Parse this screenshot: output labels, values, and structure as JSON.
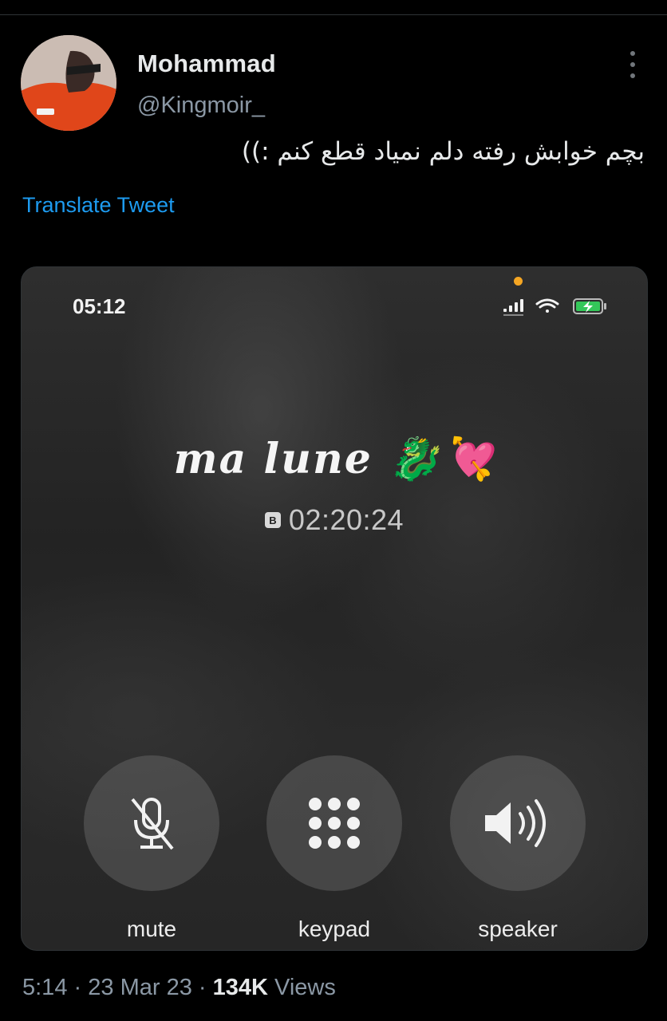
{
  "tweet": {
    "display_name": "Mohammad",
    "handle": "@Kingmoir_",
    "text": "بچم خوابش رفته دلم نمیاد قطع کنم :))",
    "translate_label": "Translate Tweet",
    "time": "5:14",
    "separator": "·",
    "date": "23 Mar 23",
    "views_count": "134K",
    "views_label": "Views"
  },
  "call_screen": {
    "status_time": "05:12",
    "caller_name": "ma lune 🐉💘",
    "sim_label": "B",
    "call_duration": "02:20:24",
    "buttons": [
      {
        "label": "mute",
        "icon": "mic-off-icon"
      },
      {
        "label": "keypad",
        "icon": "keypad-icon"
      },
      {
        "label": "speaker",
        "icon": "speaker-icon"
      }
    ]
  },
  "colors": {
    "background": "#000000",
    "link": "#1d9bf0",
    "secondary_text": "#8b98a5",
    "mic_indicator": "#f5a623",
    "battery_charging": "#34c759"
  }
}
